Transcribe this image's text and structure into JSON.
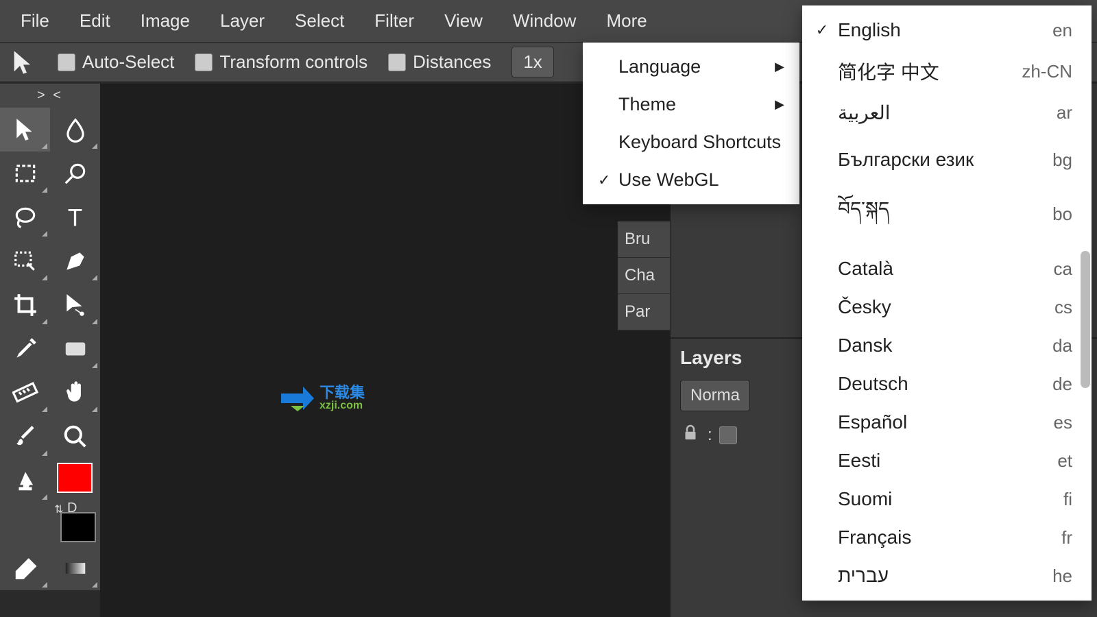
{
  "menubar": [
    "File",
    "Edit",
    "Image",
    "Layer",
    "Select",
    "Filter",
    "View",
    "Window",
    "More"
  ],
  "optionsbar": {
    "auto_select": "Auto-Select",
    "transform_controls": "Transform controls",
    "distances": "Distances",
    "zoom": "1x"
  },
  "toolbox_header": "> <",
  "swatch": {
    "swap": "⇅",
    "default": "D"
  },
  "watermark": {
    "cn": "下载集",
    "url": "xzji.com"
  },
  "panel_stub": [
    "Bru",
    "Cha",
    "Par"
  ],
  "layers": {
    "title": "Layers",
    "blend": "Norma",
    "lock_label": ":"
  },
  "more_menu": {
    "language": "Language",
    "theme": "Theme",
    "keyboard": "Keyboard Shortcuts",
    "webgl": "Use WebGL",
    "check": "✓"
  },
  "language_menu": {
    "check": "✓",
    "items": [
      {
        "name": "English",
        "code": "en",
        "selected": true
      },
      {
        "name": "简化字 中文",
        "code": "zh-CN"
      },
      {
        "name": "العربية",
        "code": "ar"
      },
      {
        "name": "Български език",
        "code": "bg",
        "gap": true
      },
      {
        "name": "བོད་སྐད",
        "code": "bo"
      },
      {
        "name": "Català",
        "code": "ca"
      },
      {
        "name": "Česky",
        "code": "cs"
      },
      {
        "name": "Dansk",
        "code": "da"
      },
      {
        "name": "Deutsch",
        "code": "de"
      },
      {
        "name": "Español",
        "code": "es"
      },
      {
        "name": "Eesti",
        "code": "et"
      },
      {
        "name": "Suomi",
        "code": "fi"
      },
      {
        "name": "Français",
        "code": "fr"
      },
      {
        "name": "עברית",
        "code": "he"
      }
    ]
  }
}
